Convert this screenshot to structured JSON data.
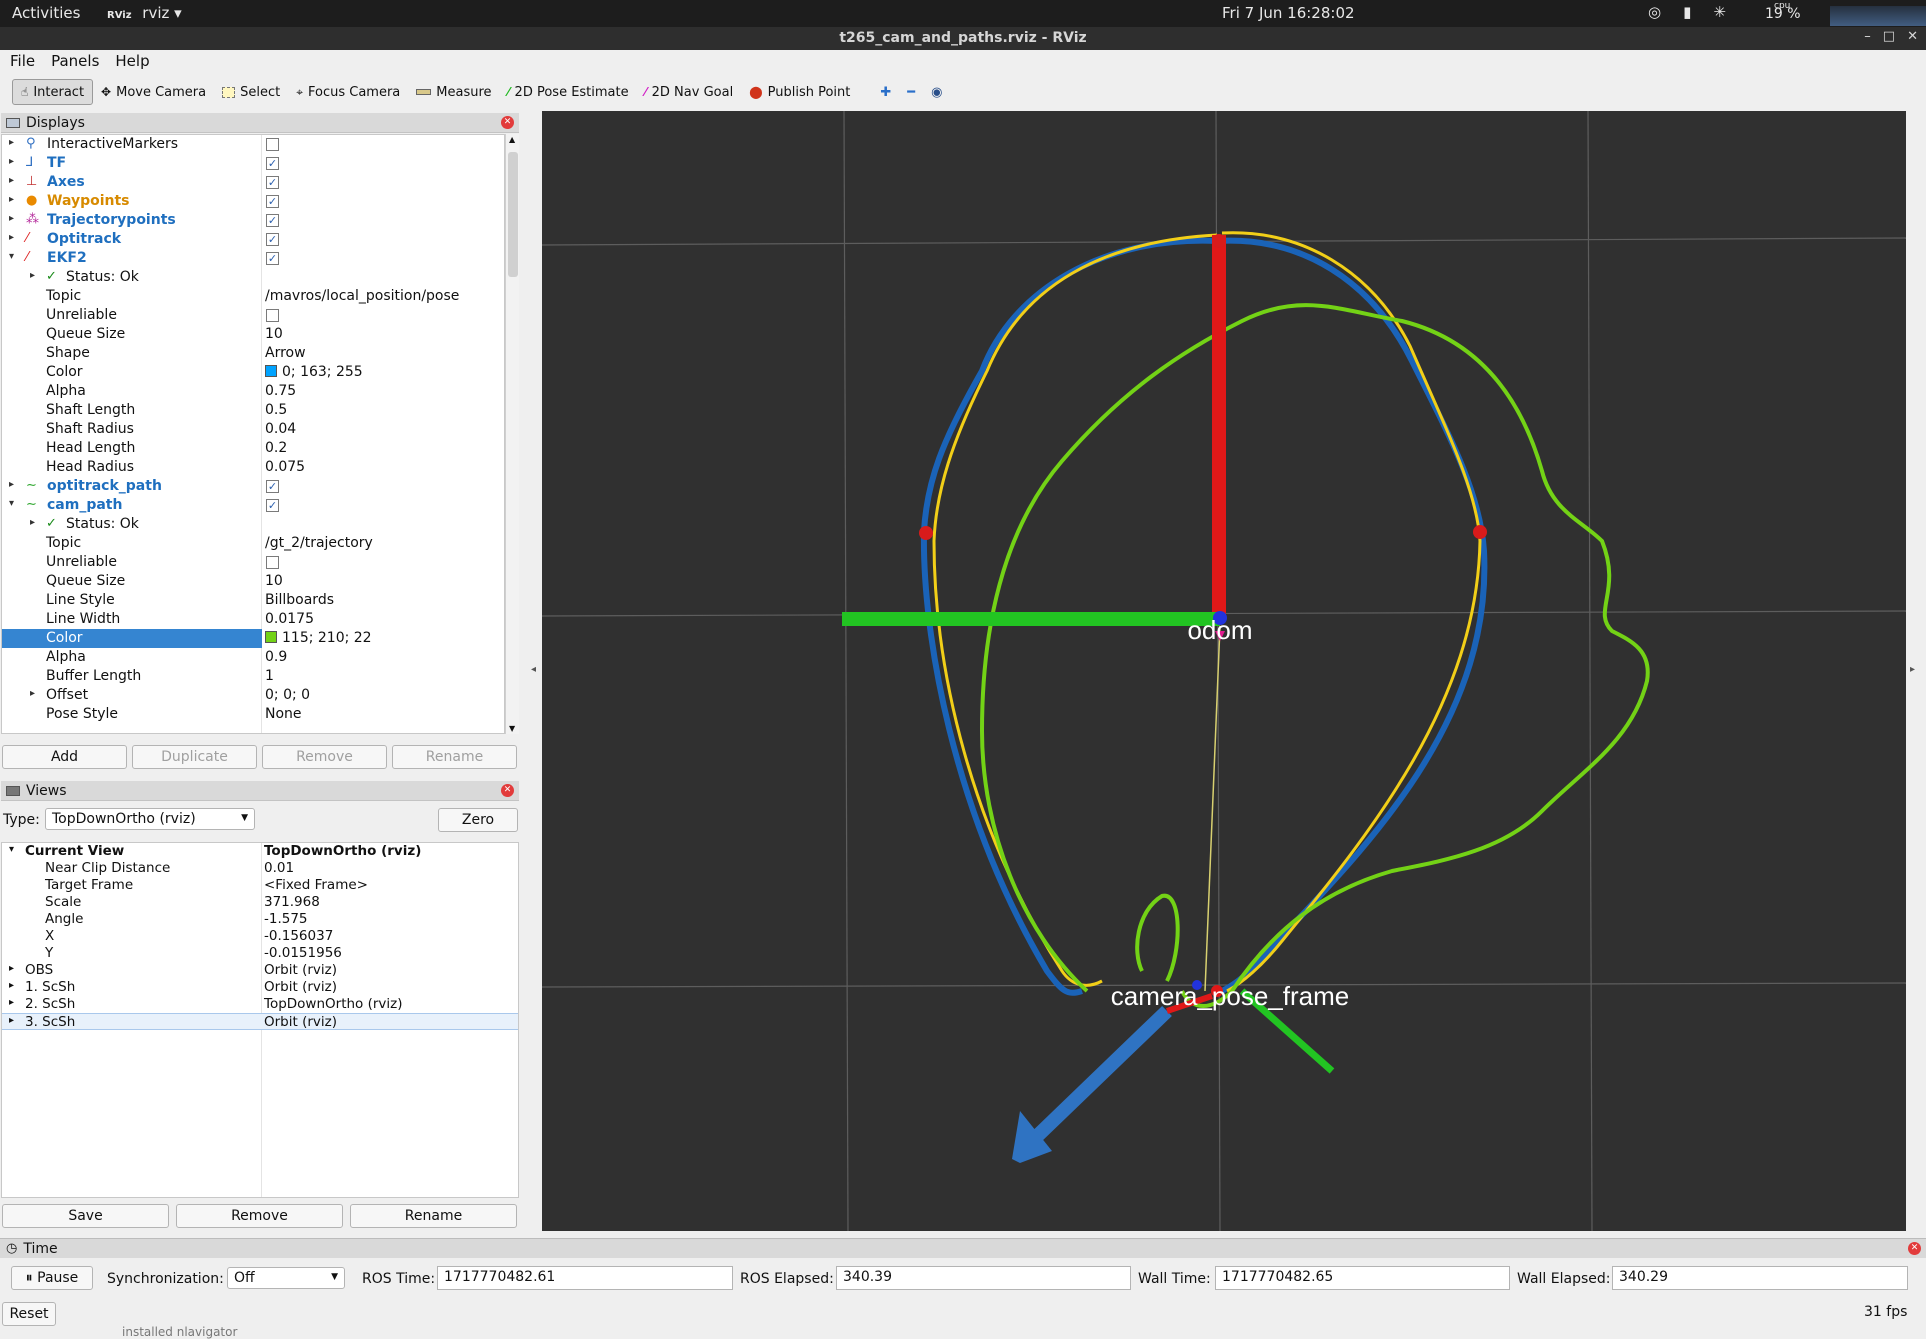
{
  "system": {
    "activities": "Activities",
    "app_name": "rviz",
    "app_logo": "RViz",
    "clock": "Fri 7 Jun  16:28:02",
    "cpu_label": "cpu",
    "cpu_value": "19 %"
  },
  "window": {
    "title": "t265_cam_and_paths.rviz - RViz",
    "minimize": "–",
    "maximize": "□",
    "close": "✕"
  },
  "menu": [
    "File",
    "Panels",
    "Help"
  ],
  "toolbar": {
    "tools": [
      {
        "label": "Interact",
        "icon": "cursor-icon"
      },
      {
        "label": "Move Camera",
        "icon": "move-camera-icon"
      },
      {
        "label": "Select",
        "icon": "select-icon"
      },
      {
        "label": "Focus Camera",
        "icon": "focus-camera-icon"
      },
      {
        "label": "Measure",
        "icon": "measure-icon"
      },
      {
        "label": "2D Pose Estimate",
        "icon": "pose-estimate-icon"
      },
      {
        "label": "2D Nav Goal",
        "icon": "nav-goal-icon"
      },
      {
        "label": "Publish Point",
        "icon": "publish-point-icon"
      }
    ],
    "active_tool": "Interact"
  },
  "displays": {
    "title": "Displays",
    "rows": [
      {
        "name": "InteractiveMarkers",
        "checked": false
      },
      {
        "name": "TF",
        "checked": true
      },
      {
        "name": "Axes",
        "checked": true
      },
      {
        "name": "Waypoints",
        "checked": true
      },
      {
        "name": "Trajectorypoints",
        "checked": true
      },
      {
        "name": "Optitrack",
        "checked": true
      },
      {
        "name": "EKF2",
        "checked": true
      },
      {
        "name": "Status: Ok"
      },
      {
        "name": "Topic",
        "value": "/mavros/local_position/pose"
      },
      {
        "name": "Unreliable",
        "checked": false
      },
      {
        "name": "Queue Size",
        "value": "10"
      },
      {
        "name": "Shape",
        "value": "Arrow"
      },
      {
        "name": "Color",
        "value": "0; 163; 255",
        "swatch": "#00a3ff"
      },
      {
        "name": "Alpha",
        "value": "0.75"
      },
      {
        "name": "Shaft Length",
        "value": "0.5"
      },
      {
        "name": "Shaft Radius",
        "value": "0.04"
      },
      {
        "name": "Head Length",
        "value": "0.2"
      },
      {
        "name": "Head Radius",
        "value": "0.075"
      },
      {
        "name": "optitrack_path",
        "checked": true
      },
      {
        "name": "cam_path",
        "checked": true
      },
      {
        "name": "Status: Ok"
      },
      {
        "name": "Topic",
        "value": "/gt_2/trajectory"
      },
      {
        "name": "Unreliable",
        "checked": false
      },
      {
        "name": "Queue Size",
        "value": "10"
      },
      {
        "name": "Line Style",
        "value": "Billboards"
      },
      {
        "name": "Line Width",
        "value": "0.0175"
      },
      {
        "name": "Color",
        "value": "115; 210; 22",
        "swatch": "#73d216"
      },
      {
        "name": "Alpha",
        "value": "0.9"
      },
      {
        "name": "Buffer Length",
        "value": "1"
      },
      {
        "name": "Offset",
        "value": "0; 0; 0"
      },
      {
        "name": "Pose Style",
        "value": "None"
      }
    ],
    "buttons": {
      "add": "Add",
      "duplicate": "Duplicate",
      "remove": "Remove",
      "rename": "Rename"
    }
  },
  "views": {
    "title": "Views",
    "type_label": "Type:",
    "type_value": "TopDownOrtho (rviz)",
    "zero": "Zero",
    "rows": [
      {
        "name": "Current View",
        "value": "TopDownOrtho (rviz)"
      },
      {
        "name": "Near Clip Distance",
        "value": "0.01"
      },
      {
        "name": "Target Frame",
        "value": "<Fixed Frame>"
      },
      {
        "name": "Scale",
        "value": "371.968"
      },
      {
        "name": "Angle",
        "value": "-1.575"
      },
      {
        "name": "X",
        "value": "-0.156037"
      },
      {
        "name": "Y",
        "value": "-0.0151956"
      },
      {
        "name": "OBS",
        "value": "Orbit (rviz)"
      },
      {
        "name": "1. ScSh",
        "value": "Orbit (rviz)"
      },
      {
        "name": "2. ScSh",
        "value": "TopDownOrtho (rviz)"
      },
      {
        "name": "3. ScSh",
        "value": "Orbit (rviz)"
      }
    ],
    "buttons": {
      "save": "Save",
      "remove": "Remove",
      "rename": "Rename"
    }
  },
  "viewport": {
    "labels": {
      "odom": "odom",
      "camera_frame": "camera_pose_frame"
    },
    "colors": {
      "background": "#303030",
      "grid": "#5a5a5a",
      "blue_path": "#1a63b8",
      "yellow_path": "#f2cf18",
      "green_path": "#73d216",
      "x_axis": "#e01818",
      "y_axis": "#22c422"
    }
  },
  "time": {
    "title": "Time",
    "pause": "Pause",
    "sync_label": "Synchronization:",
    "sync_value": "Off",
    "ros_time_label": "ROS Time:",
    "ros_time": "1717770482.61",
    "ros_elapsed_label": "ROS Elapsed:",
    "ros_elapsed": "340.39",
    "wall_time_label": "Wall Time:",
    "wall_time": "1717770482.65",
    "wall_elapsed_label": "Wall Elapsed:",
    "wall_elapsed": "340.29",
    "reset": "Reset",
    "fps": "31 fps"
  },
  "background_hint": "installed nlavigator"
}
